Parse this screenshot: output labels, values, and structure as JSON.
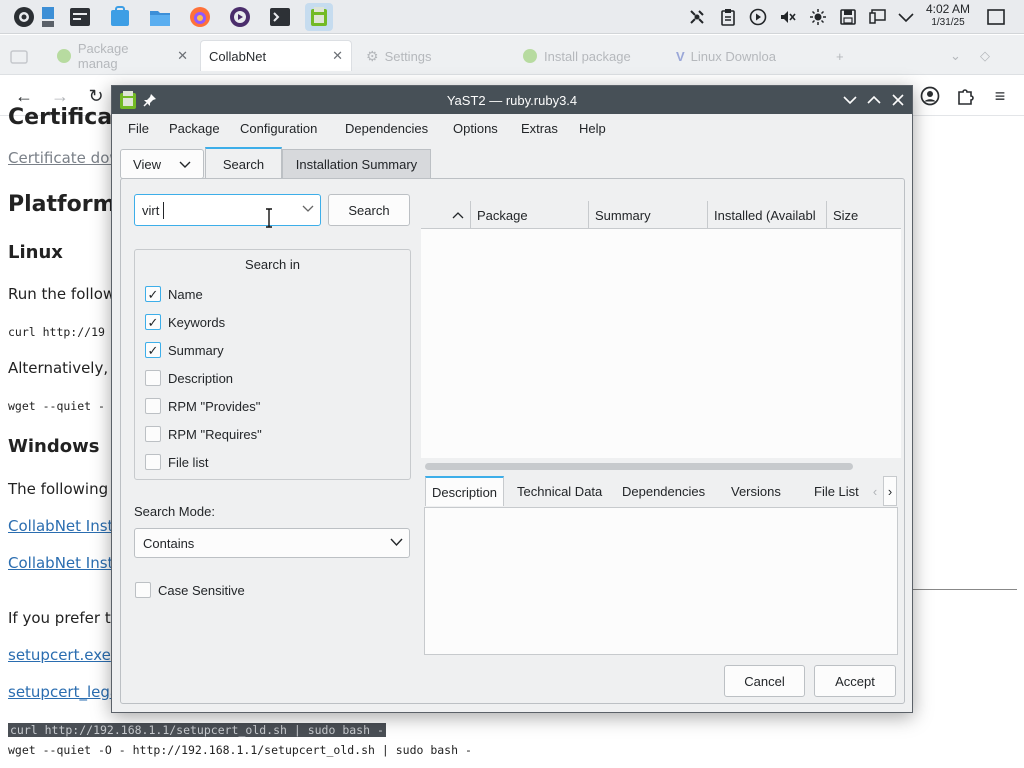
{
  "taskbar": {
    "clock_time": "4:02 AM",
    "clock_date": "1/31/25"
  },
  "browser": {
    "tabs": [
      {
        "label": "Package manag"
      },
      {
        "label": "CollabNet"
      },
      {
        "label": "Settings"
      },
      {
        "label": "Install package"
      },
      {
        "label": "Linux Downloa"
      }
    ]
  },
  "page": {
    "cert_link": "Certificate dow",
    "heading_platform": "Platform-",
    "heading_linux": "Linux",
    "run_text": "Run the follow",
    "curl_partial": "curl http://19",
    "alt_text": "Alternatively, if",
    "wget_partial": "wget --quiet -",
    "heading_windows": "Windows",
    "following_text": "The following c",
    "link_collabnet_1": "CollabNet Insta",
    "link_collabnet_2": "CollabNet Insta",
    "prefer_text": "If you prefer th",
    "link_setupcert": "setupcert.exe",
    "link_setupcert_suffix": "(",
    "link_setupcert_legacy": "setupcert_lega",
    "code_curl": "curl http://192.168.1.1/setupcert_old.sh | sudo bash -",
    "code_wget": "wget --quiet -O - http://192.168.1.1/setupcert_old.sh | sudo bash -"
  },
  "dialog": {
    "title": "YaST2 — ruby.ruby3.4",
    "menu": [
      "File",
      "Package",
      "Configuration",
      "Dependencies",
      "Options",
      "Extras",
      "Help"
    ],
    "view_label": "View",
    "tab_search": "Search",
    "tab_summary": "Installation Summary",
    "search_value": "virt",
    "search_button": "Search",
    "search_in_title": "Search in",
    "search_in": [
      {
        "label": "Name",
        "checked": true
      },
      {
        "label": "Keywords",
        "checked": true
      },
      {
        "label": "Summary",
        "checked": true
      },
      {
        "label": "Description",
        "checked": false
      },
      {
        "label": "RPM \"Provides\"",
        "checked": false
      },
      {
        "label": "RPM \"Requires\"",
        "checked": false
      },
      {
        "label": "File list",
        "checked": false
      }
    ],
    "search_mode_label": "Search Mode:",
    "search_mode_value": "Contains",
    "case_sensitive": "Case Sensitive",
    "columns": [
      "Package",
      "Summary",
      "Installed (Availabl",
      "Size"
    ],
    "detail_tabs": [
      "Description",
      "Technical Data",
      "Dependencies",
      "Versions",
      "File List"
    ],
    "cancel": "Cancel",
    "accept": "Accept"
  }
}
